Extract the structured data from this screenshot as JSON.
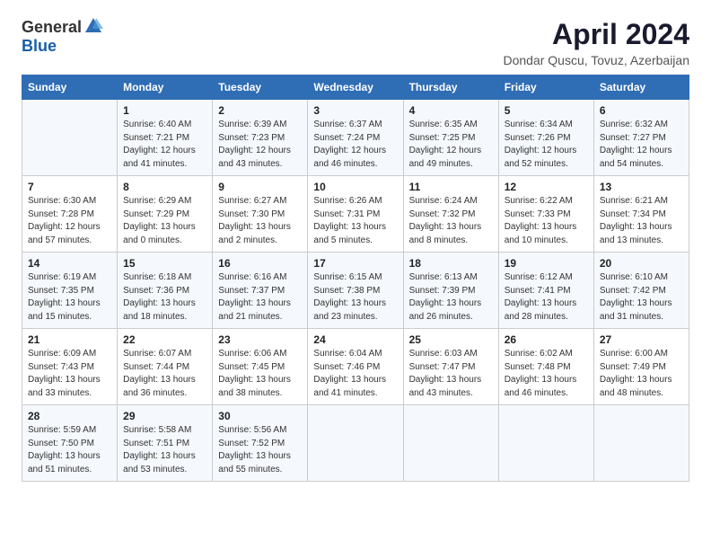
{
  "header": {
    "logo_general": "General",
    "logo_blue": "Blue",
    "month_title": "April 2024",
    "location": "Dondar Quscu, Tovuz, Azerbaijan"
  },
  "days_of_week": [
    "Sunday",
    "Monday",
    "Tuesday",
    "Wednesday",
    "Thursday",
    "Friday",
    "Saturday"
  ],
  "weeks": [
    [
      {
        "day": "",
        "info": ""
      },
      {
        "day": "1",
        "info": "Sunrise: 6:40 AM\nSunset: 7:21 PM\nDaylight: 12 hours\nand 41 minutes."
      },
      {
        "day": "2",
        "info": "Sunrise: 6:39 AM\nSunset: 7:23 PM\nDaylight: 12 hours\nand 43 minutes."
      },
      {
        "day": "3",
        "info": "Sunrise: 6:37 AM\nSunset: 7:24 PM\nDaylight: 12 hours\nand 46 minutes."
      },
      {
        "day": "4",
        "info": "Sunrise: 6:35 AM\nSunset: 7:25 PM\nDaylight: 12 hours\nand 49 minutes."
      },
      {
        "day": "5",
        "info": "Sunrise: 6:34 AM\nSunset: 7:26 PM\nDaylight: 12 hours\nand 52 minutes."
      },
      {
        "day": "6",
        "info": "Sunrise: 6:32 AM\nSunset: 7:27 PM\nDaylight: 12 hours\nand 54 minutes."
      }
    ],
    [
      {
        "day": "7",
        "info": "Sunrise: 6:30 AM\nSunset: 7:28 PM\nDaylight: 12 hours\nand 57 minutes."
      },
      {
        "day": "8",
        "info": "Sunrise: 6:29 AM\nSunset: 7:29 PM\nDaylight: 13 hours\nand 0 minutes."
      },
      {
        "day": "9",
        "info": "Sunrise: 6:27 AM\nSunset: 7:30 PM\nDaylight: 13 hours\nand 2 minutes."
      },
      {
        "day": "10",
        "info": "Sunrise: 6:26 AM\nSunset: 7:31 PM\nDaylight: 13 hours\nand 5 minutes."
      },
      {
        "day": "11",
        "info": "Sunrise: 6:24 AM\nSunset: 7:32 PM\nDaylight: 13 hours\nand 8 minutes."
      },
      {
        "day": "12",
        "info": "Sunrise: 6:22 AM\nSunset: 7:33 PM\nDaylight: 13 hours\nand 10 minutes."
      },
      {
        "day": "13",
        "info": "Sunrise: 6:21 AM\nSunset: 7:34 PM\nDaylight: 13 hours\nand 13 minutes."
      }
    ],
    [
      {
        "day": "14",
        "info": "Sunrise: 6:19 AM\nSunset: 7:35 PM\nDaylight: 13 hours\nand 15 minutes."
      },
      {
        "day": "15",
        "info": "Sunrise: 6:18 AM\nSunset: 7:36 PM\nDaylight: 13 hours\nand 18 minutes."
      },
      {
        "day": "16",
        "info": "Sunrise: 6:16 AM\nSunset: 7:37 PM\nDaylight: 13 hours\nand 21 minutes."
      },
      {
        "day": "17",
        "info": "Sunrise: 6:15 AM\nSunset: 7:38 PM\nDaylight: 13 hours\nand 23 minutes."
      },
      {
        "day": "18",
        "info": "Sunrise: 6:13 AM\nSunset: 7:39 PM\nDaylight: 13 hours\nand 26 minutes."
      },
      {
        "day": "19",
        "info": "Sunrise: 6:12 AM\nSunset: 7:41 PM\nDaylight: 13 hours\nand 28 minutes."
      },
      {
        "day": "20",
        "info": "Sunrise: 6:10 AM\nSunset: 7:42 PM\nDaylight: 13 hours\nand 31 minutes."
      }
    ],
    [
      {
        "day": "21",
        "info": "Sunrise: 6:09 AM\nSunset: 7:43 PM\nDaylight: 13 hours\nand 33 minutes."
      },
      {
        "day": "22",
        "info": "Sunrise: 6:07 AM\nSunset: 7:44 PM\nDaylight: 13 hours\nand 36 minutes."
      },
      {
        "day": "23",
        "info": "Sunrise: 6:06 AM\nSunset: 7:45 PM\nDaylight: 13 hours\nand 38 minutes."
      },
      {
        "day": "24",
        "info": "Sunrise: 6:04 AM\nSunset: 7:46 PM\nDaylight: 13 hours\nand 41 minutes."
      },
      {
        "day": "25",
        "info": "Sunrise: 6:03 AM\nSunset: 7:47 PM\nDaylight: 13 hours\nand 43 minutes."
      },
      {
        "day": "26",
        "info": "Sunrise: 6:02 AM\nSunset: 7:48 PM\nDaylight: 13 hours\nand 46 minutes."
      },
      {
        "day": "27",
        "info": "Sunrise: 6:00 AM\nSunset: 7:49 PM\nDaylight: 13 hours\nand 48 minutes."
      }
    ],
    [
      {
        "day": "28",
        "info": "Sunrise: 5:59 AM\nSunset: 7:50 PM\nDaylight: 13 hours\nand 51 minutes."
      },
      {
        "day": "29",
        "info": "Sunrise: 5:58 AM\nSunset: 7:51 PM\nDaylight: 13 hours\nand 53 minutes."
      },
      {
        "day": "30",
        "info": "Sunrise: 5:56 AM\nSunset: 7:52 PM\nDaylight: 13 hours\nand 55 minutes."
      },
      {
        "day": "",
        "info": ""
      },
      {
        "day": "",
        "info": ""
      },
      {
        "day": "",
        "info": ""
      },
      {
        "day": "",
        "info": ""
      }
    ]
  ]
}
